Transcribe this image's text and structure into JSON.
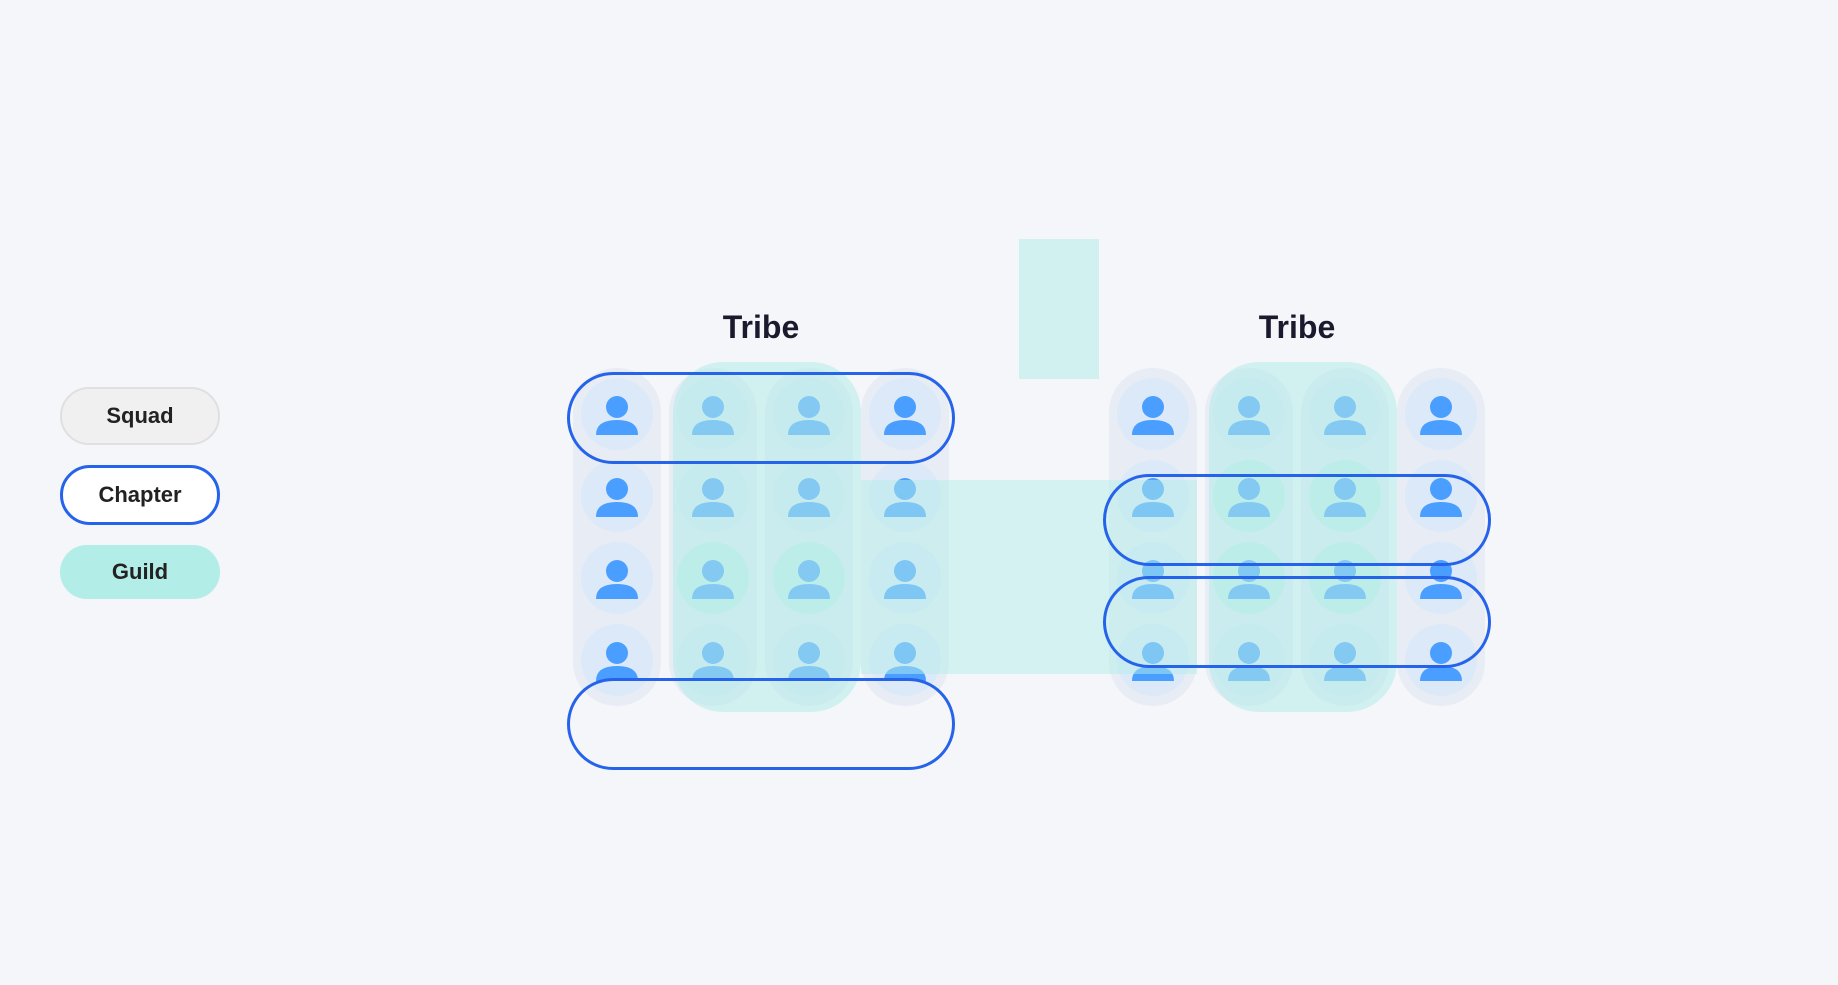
{
  "legend": {
    "items": [
      {
        "id": "squad",
        "label": "Squad",
        "style": "squad"
      },
      {
        "id": "chapter",
        "label": "Chapter",
        "style": "chapter"
      },
      {
        "id": "guild",
        "label": "Guild",
        "style": "guild"
      }
    ]
  },
  "tribes": [
    {
      "id": "tribe1",
      "title": "Tribe"
    },
    {
      "id": "tribe2",
      "title": "Tribe"
    }
  ],
  "page_bg": "#f5f6fa"
}
